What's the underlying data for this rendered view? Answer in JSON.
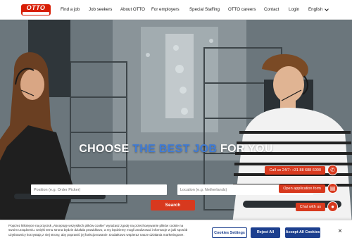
{
  "header": {
    "logo_text": "OTTO",
    "nav": [
      {
        "label": "Find a job"
      },
      {
        "label": "Job seekers"
      },
      {
        "label": "About OTTO"
      },
      {
        "label": "For employers"
      },
      {
        "label": "Special Staffing"
      },
      {
        "label": "OTTO careers"
      },
      {
        "label": "Contact"
      },
      {
        "label": "Login"
      }
    ],
    "language": "English"
  },
  "hero": {
    "headline_pre": "CHOOSE ",
    "headline_highlight": "THE BEST JOB",
    "headline_post": " FOR YOU",
    "position_placeholder": "Position (e.g. Order Picker)",
    "location_placeholder": "Location (e.g. Netherlands)",
    "search_label": "Search"
  },
  "side_actions": {
    "call_label": "Call us 24/7: +31 88 688 6000",
    "application_label": "Open application form",
    "chat_label": "Chat with us"
  },
  "cookie": {
    "text_1": "Poprzez kliknięcie na przycisk „Akceptuję wszystkich plików cookie” wyrażasz zgodę na przechowywanie plików cookie na swoim urządzeniu. Dzięki temu strona będzie działała prawidłowo, a my będziemy mogli analizować informacje w jaki sposób użytkownicy korzystają z niej strony, aby poprawić jej funkcjonowanie. Dodatkowo wspieraz nasze działania marketingowe.",
    "settings_label": "Cookies Settings",
    "reject_label": "Reject All",
    "accept_label": "Accept All Cookies",
    "close_label": "×"
  },
  "colors": {
    "brand_red": "#d8391e",
    "highlight_blue": "#3f7bd6",
    "cookie_blue": "#1c3f8e"
  }
}
